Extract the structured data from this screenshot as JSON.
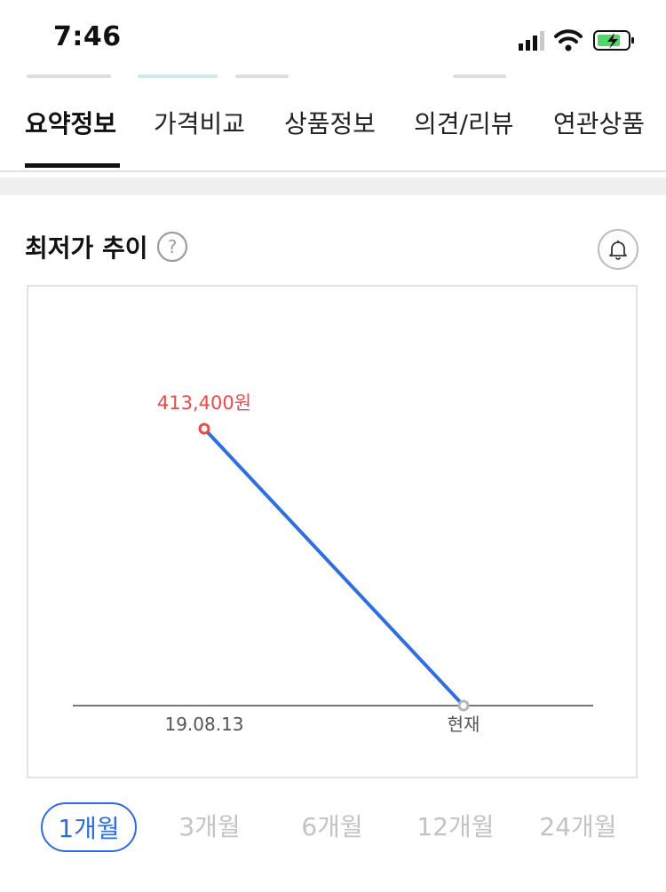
{
  "status_bar": {
    "time": "7:46"
  },
  "tabs": [
    {
      "label": "요약정보",
      "active": true
    },
    {
      "label": "가격비교",
      "active": false
    },
    {
      "label": "상품정보",
      "active": false
    },
    {
      "label": "의견/리뷰",
      "active": false
    },
    {
      "label": "연관상품",
      "active": false
    }
  ],
  "section": {
    "title": "최저가 추이",
    "help_icon": "question-circle-icon",
    "alert_icon": "bell-icon"
  },
  "chart_data": {
    "type": "line",
    "x": [
      "19.08.13",
      "현재"
    ],
    "series": [
      {
        "values": [
          413400,
          0
        ],
        "labels": [
          "413,400원",
          ""
        ]
      }
    ],
    "title": "",
    "xlabel": "",
    "ylabel": "",
    "colors": {
      "line": "#2f6fe0",
      "high_point": "#e94b4b",
      "end_point": "#b5b5b5",
      "baseline": "#777777"
    }
  },
  "periods": [
    {
      "label": "1개월",
      "active": true
    },
    {
      "label": "3개월",
      "active": false
    },
    {
      "label": "6개월",
      "active": false
    },
    {
      "label": "12개월",
      "active": false
    },
    {
      "label": "24개월",
      "active": false
    }
  ]
}
